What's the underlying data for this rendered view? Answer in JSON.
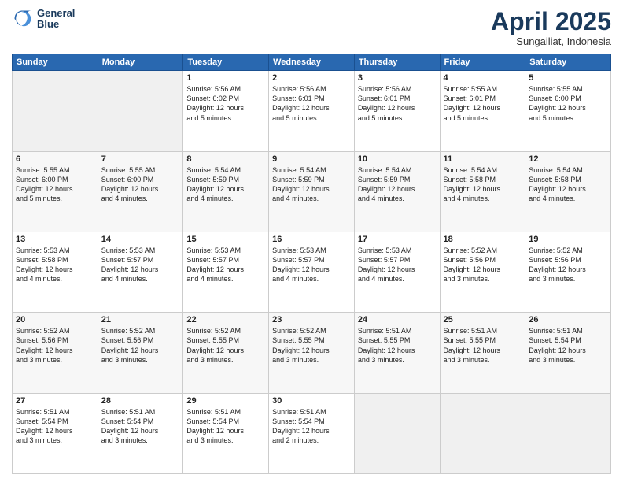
{
  "logo": {
    "line1": "General",
    "line2": "Blue"
  },
  "title": "April 2025",
  "subtitle": "Sungailiat, Indonesia",
  "days": [
    "Sunday",
    "Monday",
    "Tuesday",
    "Wednesday",
    "Thursday",
    "Friday",
    "Saturday"
  ],
  "weeks": [
    [
      {
        "day": "",
        "info": ""
      },
      {
        "day": "",
        "info": ""
      },
      {
        "day": "1",
        "info": "Sunrise: 5:56 AM\nSunset: 6:02 PM\nDaylight: 12 hours\nand 5 minutes."
      },
      {
        "day": "2",
        "info": "Sunrise: 5:56 AM\nSunset: 6:01 PM\nDaylight: 12 hours\nand 5 minutes."
      },
      {
        "day": "3",
        "info": "Sunrise: 5:56 AM\nSunset: 6:01 PM\nDaylight: 12 hours\nand 5 minutes."
      },
      {
        "day": "4",
        "info": "Sunrise: 5:55 AM\nSunset: 6:01 PM\nDaylight: 12 hours\nand 5 minutes."
      },
      {
        "day": "5",
        "info": "Sunrise: 5:55 AM\nSunset: 6:00 PM\nDaylight: 12 hours\nand 5 minutes."
      }
    ],
    [
      {
        "day": "6",
        "info": "Sunrise: 5:55 AM\nSunset: 6:00 PM\nDaylight: 12 hours\nand 5 minutes."
      },
      {
        "day": "7",
        "info": "Sunrise: 5:55 AM\nSunset: 6:00 PM\nDaylight: 12 hours\nand 4 minutes."
      },
      {
        "day": "8",
        "info": "Sunrise: 5:54 AM\nSunset: 5:59 PM\nDaylight: 12 hours\nand 4 minutes."
      },
      {
        "day": "9",
        "info": "Sunrise: 5:54 AM\nSunset: 5:59 PM\nDaylight: 12 hours\nand 4 minutes."
      },
      {
        "day": "10",
        "info": "Sunrise: 5:54 AM\nSunset: 5:59 PM\nDaylight: 12 hours\nand 4 minutes."
      },
      {
        "day": "11",
        "info": "Sunrise: 5:54 AM\nSunset: 5:58 PM\nDaylight: 12 hours\nand 4 minutes."
      },
      {
        "day": "12",
        "info": "Sunrise: 5:54 AM\nSunset: 5:58 PM\nDaylight: 12 hours\nand 4 minutes."
      }
    ],
    [
      {
        "day": "13",
        "info": "Sunrise: 5:53 AM\nSunset: 5:58 PM\nDaylight: 12 hours\nand 4 minutes."
      },
      {
        "day": "14",
        "info": "Sunrise: 5:53 AM\nSunset: 5:57 PM\nDaylight: 12 hours\nand 4 minutes."
      },
      {
        "day": "15",
        "info": "Sunrise: 5:53 AM\nSunset: 5:57 PM\nDaylight: 12 hours\nand 4 minutes."
      },
      {
        "day": "16",
        "info": "Sunrise: 5:53 AM\nSunset: 5:57 PM\nDaylight: 12 hours\nand 4 minutes."
      },
      {
        "day": "17",
        "info": "Sunrise: 5:53 AM\nSunset: 5:57 PM\nDaylight: 12 hours\nand 4 minutes."
      },
      {
        "day": "18",
        "info": "Sunrise: 5:52 AM\nSunset: 5:56 PM\nDaylight: 12 hours\nand 3 minutes."
      },
      {
        "day": "19",
        "info": "Sunrise: 5:52 AM\nSunset: 5:56 PM\nDaylight: 12 hours\nand 3 minutes."
      }
    ],
    [
      {
        "day": "20",
        "info": "Sunrise: 5:52 AM\nSunset: 5:56 PM\nDaylight: 12 hours\nand 3 minutes."
      },
      {
        "day": "21",
        "info": "Sunrise: 5:52 AM\nSunset: 5:56 PM\nDaylight: 12 hours\nand 3 minutes."
      },
      {
        "day": "22",
        "info": "Sunrise: 5:52 AM\nSunset: 5:55 PM\nDaylight: 12 hours\nand 3 minutes."
      },
      {
        "day": "23",
        "info": "Sunrise: 5:52 AM\nSunset: 5:55 PM\nDaylight: 12 hours\nand 3 minutes."
      },
      {
        "day": "24",
        "info": "Sunrise: 5:51 AM\nSunset: 5:55 PM\nDaylight: 12 hours\nand 3 minutes."
      },
      {
        "day": "25",
        "info": "Sunrise: 5:51 AM\nSunset: 5:55 PM\nDaylight: 12 hours\nand 3 minutes."
      },
      {
        "day": "26",
        "info": "Sunrise: 5:51 AM\nSunset: 5:54 PM\nDaylight: 12 hours\nand 3 minutes."
      }
    ],
    [
      {
        "day": "27",
        "info": "Sunrise: 5:51 AM\nSunset: 5:54 PM\nDaylight: 12 hours\nand 3 minutes."
      },
      {
        "day": "28",
        "info": "Sunrise: 5:51 AM\nSunset: 5:54 PM\nDaylight: 12 hours\nand 3 minutes."
      },
      {
        "day": "29",
        "info": "Sunrise: 5:51 AM\nSunset: 5:54 PM\nDaylight: 12 hours\nand 3 minutes."
      },
      {
        "day": "30",
        "info": "Sunrise: 5:51 AM\nSunset: 5:54 PM\nDaylight: 12 hours\nand 2 minutes."
      },
      {
        "day": "",
        "info": ""
      },
      {
        "day": "",
        "info": ""
      },
      {
        "day": "",
        "info": ""
      }
    ]
  ]
}
